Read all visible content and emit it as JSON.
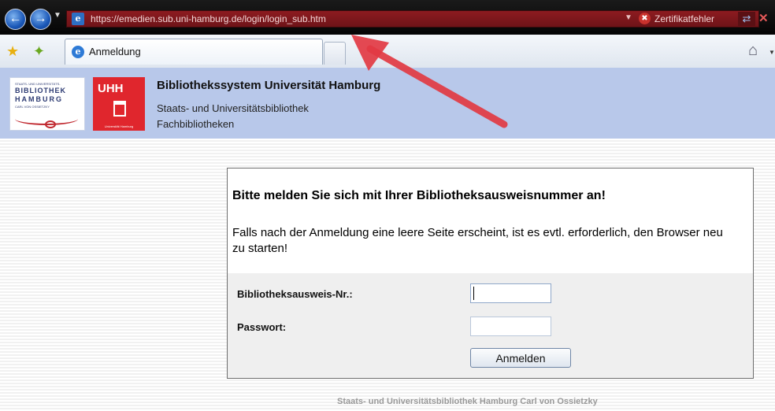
{
  "browser": {
    "url": "https://emedien.sub.uni-hamburg.de/login/login_sub.htm",
    "certificate_error_label": "Zertifikatfehler",
    "tab": {
      "label": "Anmeldung"
    },
    "icons": {
      "back": "back-arrow-icon",
      "forward": "forward-arrow-icon",
      "favorites": "star-icon",
      "add_favorites": "add-favorites-icon",
      "home": "home-icon",
      "stop": "stop-icon"
    }
  },
  "header": {
    "logo_sub": {
      "small_text": "STAATS- UND UNIVERSITÄTS-",
      "line1": "BIBLIOTHEK",
      "line2": "HAMBURG",
      "line3": "CARL VON OSSIETZKY"
    },
    "logo_uhh": {
      "mark": "UHH",
      "caption": "Universität Hamburg"
    },
    "title": "Bibliothekssystem Universität Hamburg",
    "subtitle1": "Staats- und Universitätsbibliothek",
    "subtitle2": "Fachbibliotheken",
    "background_color": "#b8c8ea"
  },
  "login": {
    "heading": "Bitte melden Sie sich mit Ihrer Bibliotheksausweisnummer an!",
    "notice": "Falls nach der Anmeldung eine leere Seite erscheint, ist es evtl. erforderlich, den Browser neu zu starten!",
    "card_number_label": "Bibliotheksausweis-Nr.:",
    "card_number_value": "",
    "password_label": "Passwort:",
    "password_value": "",
    "submit_label": "Anmelden"
  },
  "footer": {
    "text": "Staats- und Universitätsbibliothek Hamburg Carl von Ossietzky"
  },
  "colors": {
    "address_bar_error": "#8d1b20",
    "annotation_arrow": "#e23a43",
    "uhh_red": "#e0262d"
  }
}
